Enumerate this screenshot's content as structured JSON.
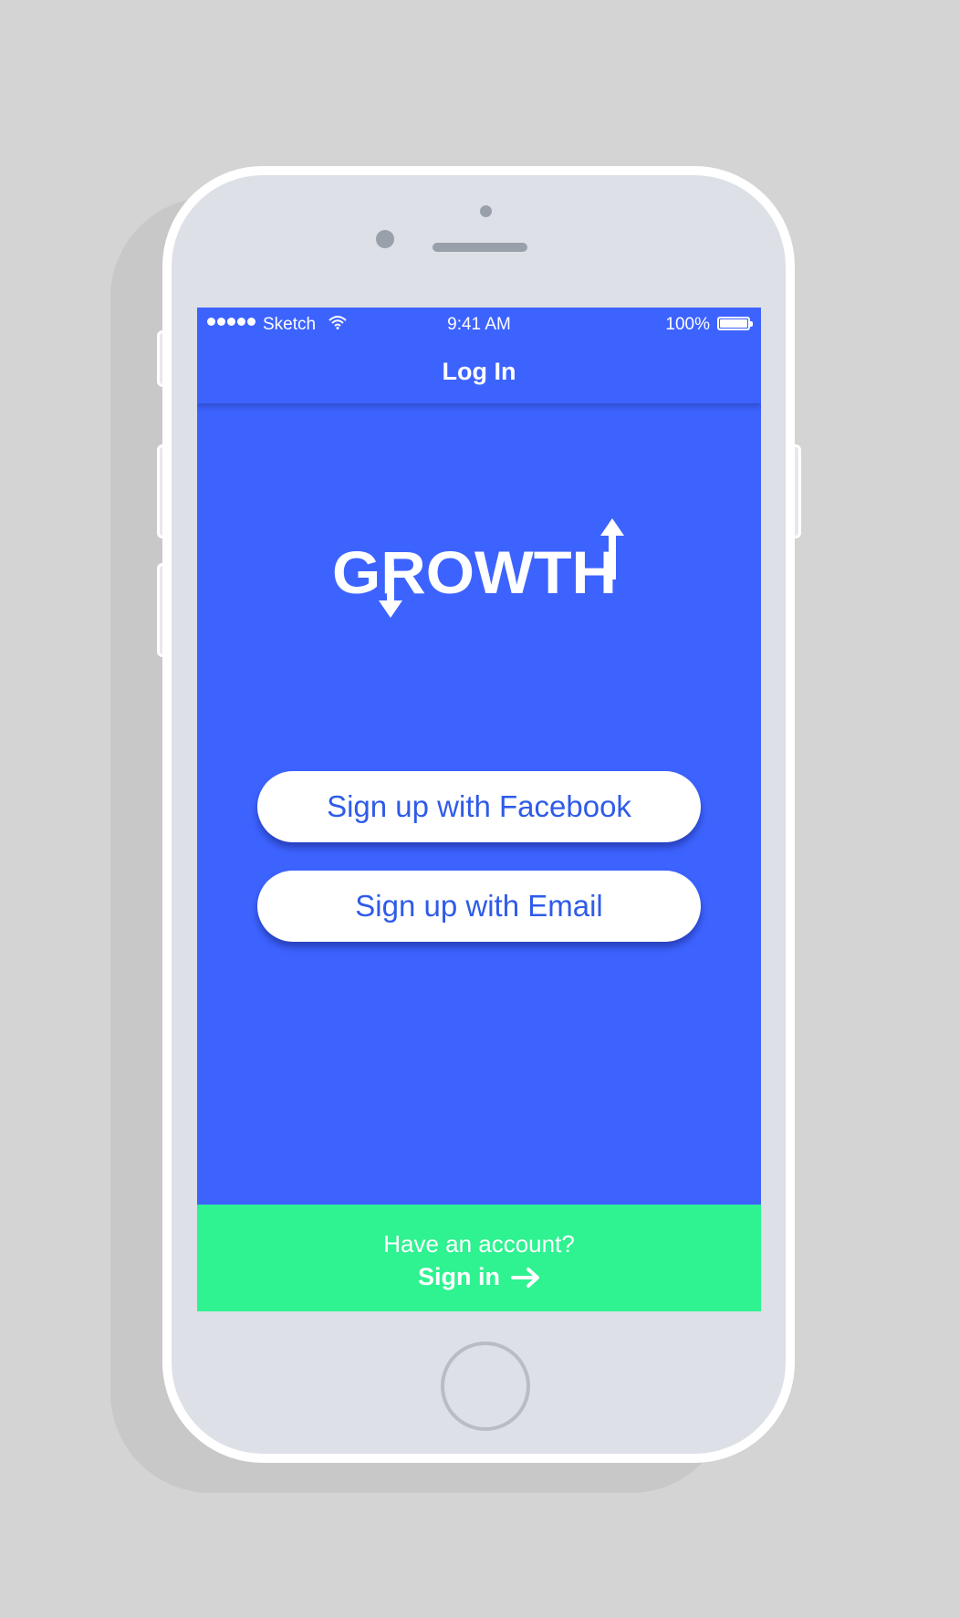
{
  "status_bar": {
    "carrier": "Sketch",
    "time": "9:41 AM",
    "battery": "100%",
    "icons": [
      "signal-dots-icon",
      "wifi-icon",
      "battery-icon"
    ]
  },
  "nav": {
    "title": "Log In"
  },
  "logo": {
    "text": "GROWTH"
  },
  "buttons": {
    "facebook": "Sign up with Facebook",
    "email": "Sign up with Email"
  },
  "footer": {
    "prompt": "Have an account?",
    "signin": "Sign in",
    "arrow_icon": "arrow-right-icon"
  },
  "colors": {
    "background": "#d4d4d4",
    "screen": "#3d63ff",
    "footer": "#2ff291",
    "button_text": "#2f5be8"
  }
}
